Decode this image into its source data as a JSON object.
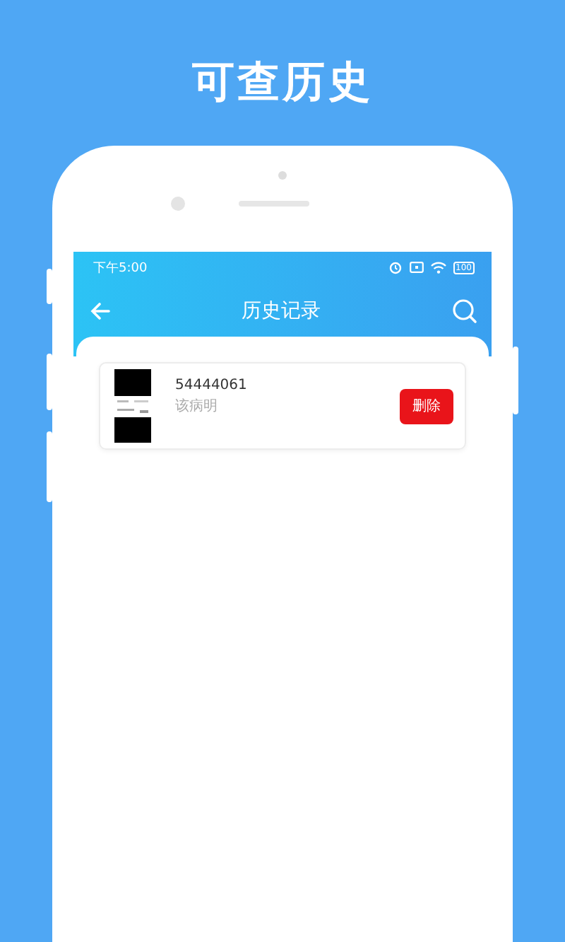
{
  "headline": "可查历史",
  "status_bar": {
    "time": "下午5:00",
    "battery": "100"
  },
  "nav": {
    "title": "历史记录"
  },
  "records": [
    {
      "kind": "picture",
      "number": "54444061",
      "subtitle": "该病明",
      "action": "删除"
    }
  ]
}
